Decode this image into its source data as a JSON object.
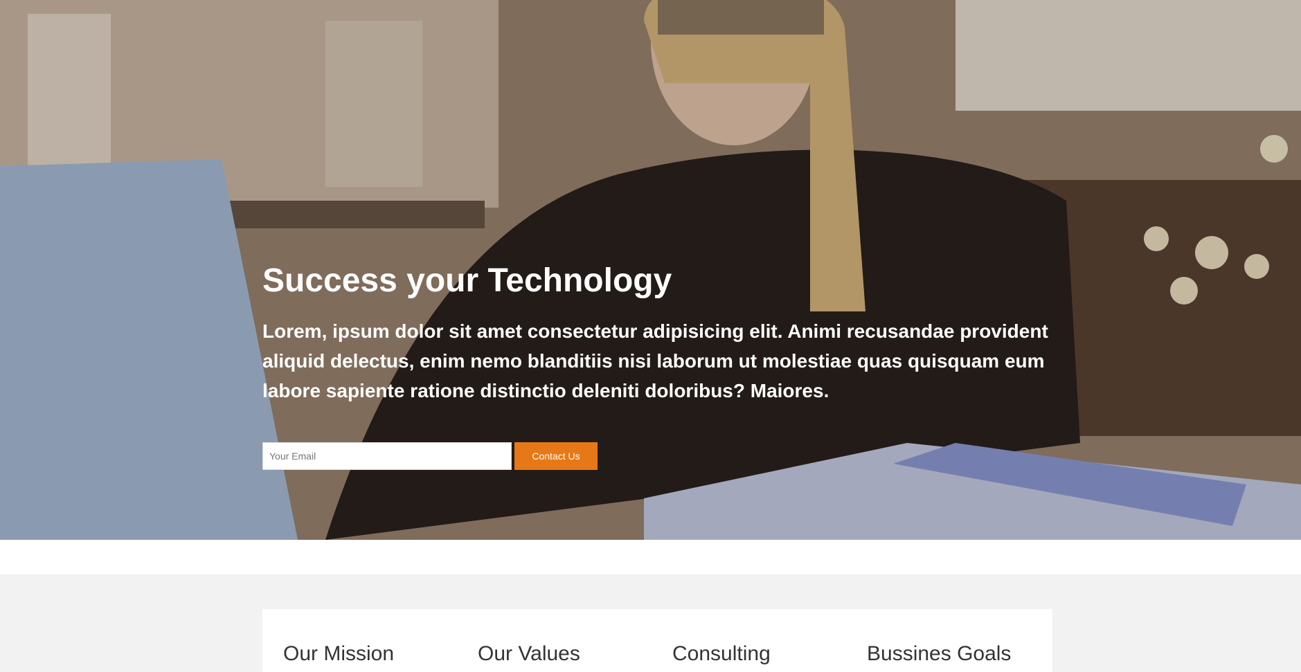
{
  "hero": {
    "title": "Success your Technology",
    "text": "Lorem, ipsum dolor sit amet consectetur adipisicing elit. Animi recusandae provident aliquid delectus, enim nemo blanditiis nisi laborum ut molestiae quas quisquam eum labore sapiente ratione distinctio deleniti doloribus? Maiores.",
    "email_placeholder": "Your Email",
    "contact_label": "Contact Us",
    "background_image": "woman-with-laptop-photo"
  },
  "features": {
    "items": [
      {
        "title": "Our Mission"
      },
      {
        "title": "Our Values"
      },
      {
        "title": "Consulting"
      },
      {
        "title": "Bussines Goals"
      }
    ]
  },
  "colors": {
    "accent": "#e77817",
    "band_background": "#f2f2f2",
    "heading_text": "#333333"
  }
}
